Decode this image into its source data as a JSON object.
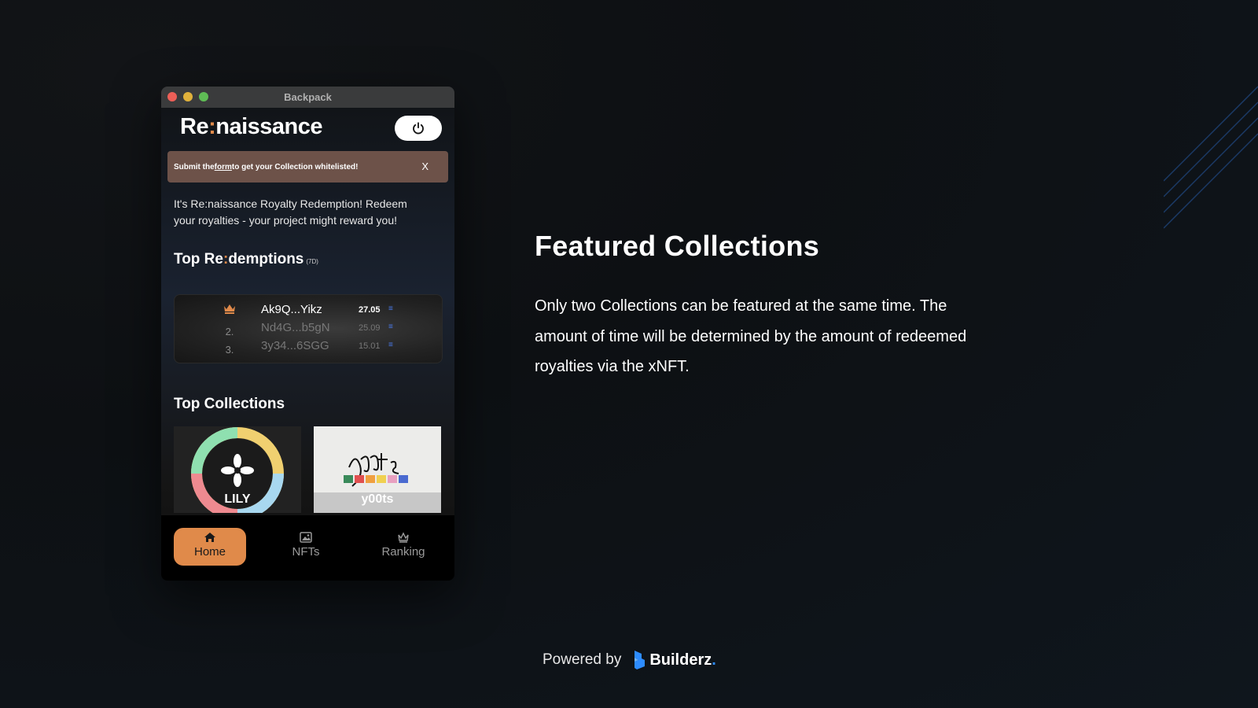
{
  "window": {
    "title": "Backpack"
  },
  "app": {
    "logo_prefix": "Re",
    "logo_colon": ":",
    "logo_suffix": "naissance",
    "banner": {
      "text_before": "Submit the ",
      "link": "form",
      "text_after": " to get your Collection whitelisted!",
      "close": "X"
    },
    "intro": "It's Re:naissance Royalty Redemption! Redeem your royalties - your project might reward you!",
    "top_redemptions": {
      "title_prefix": "Top Re",
      "title_colon": ":",
      "title_suffix": "demptions",
      "period": "(7D)",
      "rows": [
        {
          "rank": "crown-icon",
          "address": "Ak9Q...Yikz",
          "amount": "27.05"
        },
        {
          "rank": "2.",
          "address": "Nd4G...b5gN",
          "amount": "25.09"
        },
        {
          "rank": "3.",
          "address": "3y34...6SGG",
          "amount": "15.01"
        }
      ]
    },
    "top_collections": {
      "title": "Top Collections",
      "items": [
        {
          "name": "LILY"
        },
        {
          "name": "y00ts"
        }
      ]
    },
    "nav": {
      "home": "Home",
      "nfts": "NFTs",
      "ranking": "Ranking"
    }
  },
  "feature": {
    "title": "Featured Collections",
    "body": "Only two Collections can be featured at the same time. The amount of time will be determined by the amount of redeemed royalties via the xNFT."
  },
  "footer": {
    "powered_by": "Powered by",
    "brand": "Builderz",
    "brand_dot": "."
  },
  "colors": {
    "accent": "#e08a4a",
    "background": "#0f1318",
    "sol": "#4b7cf0"
  }
}
